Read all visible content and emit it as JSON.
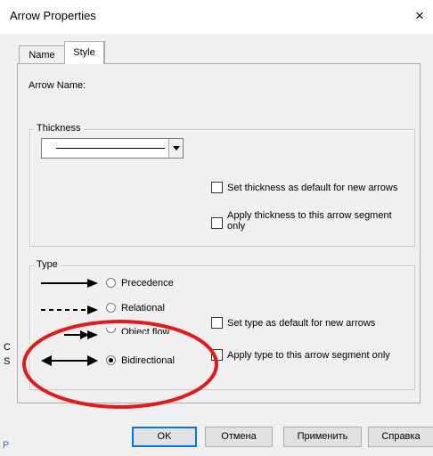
{
  "window": {
    "title": "Arrow Properties",
    "close_glyph": "×"
  },
  "tabs": [
    {
      "label": "Name",
      "active": false
    },
    {
      "label": "Style",
      "active": true
    }
  ],
  "arrow_name_label": "Arrow Name:",
  "thickness": {
    "legend": "Thickness",
    "set_default_label": "Set thickness as default for new arrows",
    "set_default_checked": false,
    "apply_segment_label": "Apply thickness to this arrow segment only",
    "apply_segment_checked": false
  },
  "type": {
    "legend": "Type",
    "options": [
      {
        "label": "Precedence",
        "line_style": "solid",
        "checked": false
      },
      {
        "label": "Relational",
        "line_style": "dashed",
        "checked": false
      },
      {
        "label": "Object flow",
        "line_style": "double",
        "checked": false
      },
      {
        "label": "Bidirectional",
        "line_style": "bidirectional",
        "checked": true
      }
    ],
    "set_default_label": "Set type as default for new arrows",
    "set_default_checked": false,
    "apply_segment_label": "Apply type to this arrow segment only",
    "apply_segment_checked": false
  },
  "buttons": {
    "ok": "OK",
    "cancel": "Отмена",
    "apply": "Применить",
    "help": "Справка"
  },
  "colors": {
    "annotation_ellipse": "#e01b1b",
    "ok_focus": "#0078d7",
    "dialog_bg": "#f0f0f0"
  },
  "background_edge": {
    "letter_c": "C",
    "letter_s": "S",
    "letter_p": "P"
  }
}
